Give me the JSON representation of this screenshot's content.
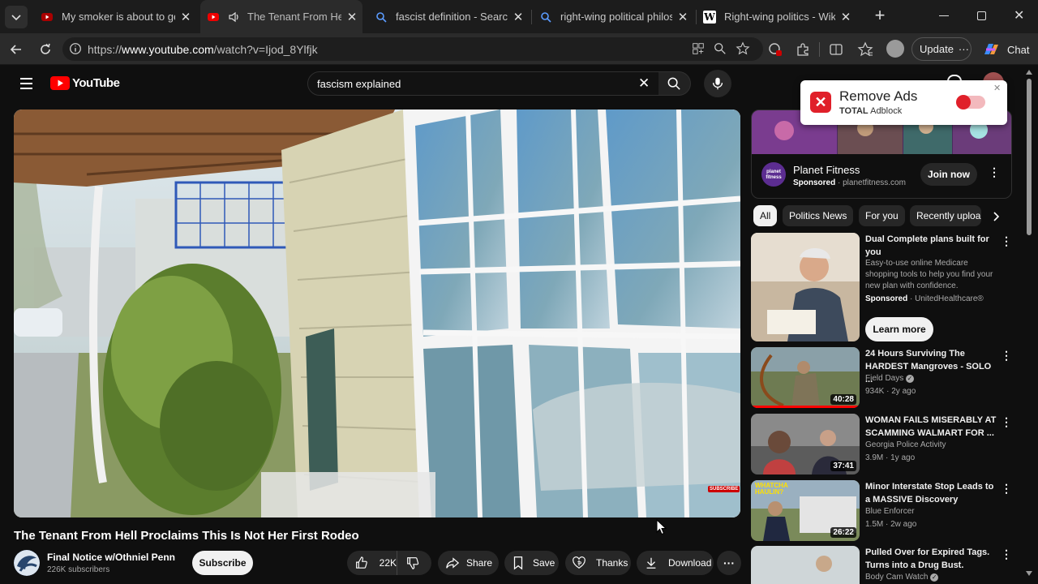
{
  "browser": {
    "tabs": [
      {
        "title": "My smoker is about to get a",
        "active": false
      },
      {
        "title": "The Tenant From Hell P",
        "active": true
      },
      {
        "title": "fascist definition - Search",
        "active": false
      },
      {
        "title": "right-wing political philosop",
        "active": false
      },
      {
        "title": "Right-wing politics - Wikipe",
        "active": false
      }
    ],
    "url_prefix": "https://",
    "url_host": "www.youtube.com",
    "url_path": "/watch?v=Ijod_8Ylfjk",
    "update_label": "Update",
    "chat_label": "Chat"
  },
  "youtube": {
    "logo_text": "YouTube",
    "search_value": "fascism explained"
  },
  "video": {
    "title": "The Tenant From Hell Proclaims This Is Not Her First Rodeo",
    "overlay_label": "SUBSCRIBE",
    "channel_name": "Final Notice w/Othniel Penn",
    "subscribers": "226K subscribers",
    "subscribe_label": "Subscribe",
    "likes": "22K",
    "share_label": "Share",
    "save_label": "Save",
    "thanks_label": "Thanks",
    "download_label": "Download"
  },
  "adblock": {
    "title": "Remove Ads",
    "brand_bold": "TOTAL",
    "brand_rest": " Adblock"
  },
  "ad": {
    "advertiser": "Planet Fitness",
    "logo_text": "planet fitness",
    "sponsored": "Sponsored",
    "domain": "planetfitness.com",
    "cta": "Join now"
  },
  "chips": [
    "All",
    "Politics News",
    "For you",
    "Recently uploa"
  ],
  "recommendations": [
    {
      "title": "Dual Complete plans built for you",
      "description": "Easy-to-use online Medicare shopping tools to help you find your new plan with confidence.",
      "sponsored": "Sponsored",
      "sponsor": "UnitedHealthcare®",
      "cta": "Learn more"
    },
    {
      "title": "24 Hours Surviving The HARDEST Mangroves - SOLO ...",
      "channel": "Field Days",
      "views": "934K",
      "age": "2y ago",
      "duration": "40:28",
      "verified": true
    },
    {
      "title": "WOMAN FAILS MISERABLY AT SCAMMING WALMART FOR ...",
      "channel": "Georgia Police Activity",
      "views": "3.9M",
      "age": "1y ago",
      "duration": "37:41",
      "verified": false
    },
    {
      "title": "Minor Interstate Stop Leads to a MASSIVE Discovery",
      "channel": "Blue Enforcer",
      "views": "1.5M",
      "age": "2w ago",
      "duration": "26:22",
      "verified": false,
      "thumb_text": "WHATCHA HAULIN?"
    },
    {
      "title": "Pulled Over for Expired Tags. Turns into a Drug Bust.",
      "channel": "Body Cam Watch",
      "verified": true
    }
  ],
  "colors": {
    "yt_red": "#ff0000",
    "bg": "#0f0f0f",
    "chip": "#272727"
  }
}
